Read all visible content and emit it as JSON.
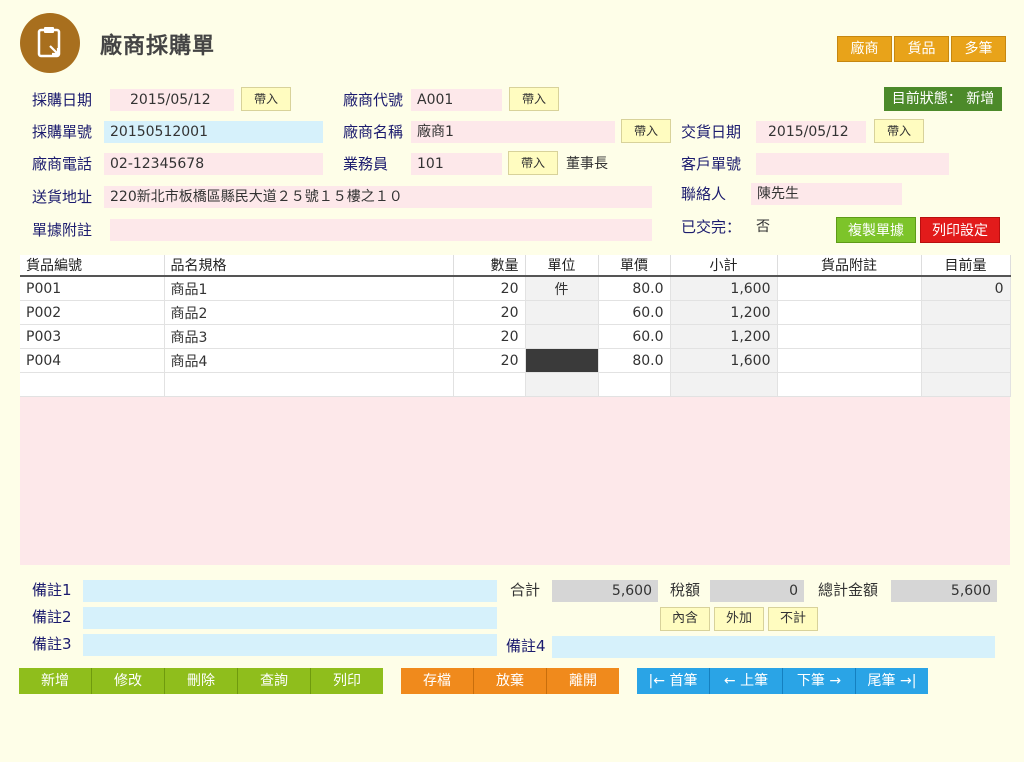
{
  "title": "廠商採購單",
  "top_buttons": [
    "廠商",
    "貨品",
    "多筆"
  ],
  "status": {
    "label": "目前狀態：",
    "value": "新增"
  },
  "import_label": "帶入",
  "form": {
    "purchase_date_label": "採購日期",
    "purchase_date": "2015/05/12",
    "purchase_no_label": "採購單號",
    "purchase_no": "20150512001",
    "vendor_phone_label": "廠商電話",
    "vendor_phone": "02-12345678",
    "ship_address_label": "送貨地址",
    "ship_address": "220新北市板橋區縣民大道２５號１５樓之１０",
    "doc_note_label": "單據附註",
    "doc_note": "",
    "vendor_code_label": "廠商代號",
    "vendor_code": "A001",
    "vendor_name_label": "廠商名稱",
    "vendor_name": "廠商1",
    "salesperson_label": "業務員",
    "salesperson": "101",
    "salesperson_title": "董事長",
    "delivery_date_label": "交貨日期",
    "delivery_date": "2015/05/12",
    "customer_no_label": "客戶單號",
    "customer_no": "",
    "contact_label": "聯絡人",
    "contact": "陳先生",
    "delivered_label": "已交完：",
    "delivered": "否",
    "copy_label": "複製單據",
    "print_setting_label": "列印設定"
  },
  "table": {
    "headers": [
      "貨品編號",
      "品名規格",
      "數量",
      "單位",
      "單價",
      "小計",
      "貨品附註",
      "目前量"
    ],
    "rows": [
      [
        "P001",
        "商品1",
        "20",
        "件",
        "80.0",
        "1,600",
        "",
        "0"
      ],
      [
        "P002",
        "商品2",
        "20",
        "",
        "60.0",
        "1,200",
        "",
        ""
      ],
      [
        "P003",
        "商品3",
        "20",
        "",
        "60.0",
        "1,200",
        "",
        ""
      ],
      [
        "P004",
        "商品4",
        "20",
        "",
        "80.0",
        "1,600",
        "",
        ""
      ],
      [
        "",
        "",
        "",
        "",
        "",
        "",
        "",
        ""
      ]
    ]
  },
  "footer": {
    "note1_label": "備註1",
    "note2_label": "備註2",
    "note3_label": "備註3",
    "note4_label": "備註4",
    "total_label": "合計",
    "total": "5,600",
    "tax_label": "稅額",
    "tax": "0",
    "grand_total_label": "總計金額",
    "grand_total": "5,600",
    "tax_options": [
      "內含",
      "外加",
      "不計"
    ]
  },
  "bottom_buttons": {
    "crud": [
      "新增",
      "修改",
      "刪除",
      "查詢",
      "列印"
    ],
    "actions": [
      "存檔",
      "放棄",
      "離開"
    ],
    "nav": [
      "|← 首筆",
      "← 上筆",
      "下筆 →",
      "尾筆 →|"
    ]
  },
  "colors": {
    "background": "#fefee8",
    "label": "#1b1b6e",
    "field_pink": "#fde8ea",
    "field_blue": "#d6f1fb",
    "orange": "#e8a31a",
    "green": "#8fbe1c",
    "blue": "#2aa4e6"
  }
}
